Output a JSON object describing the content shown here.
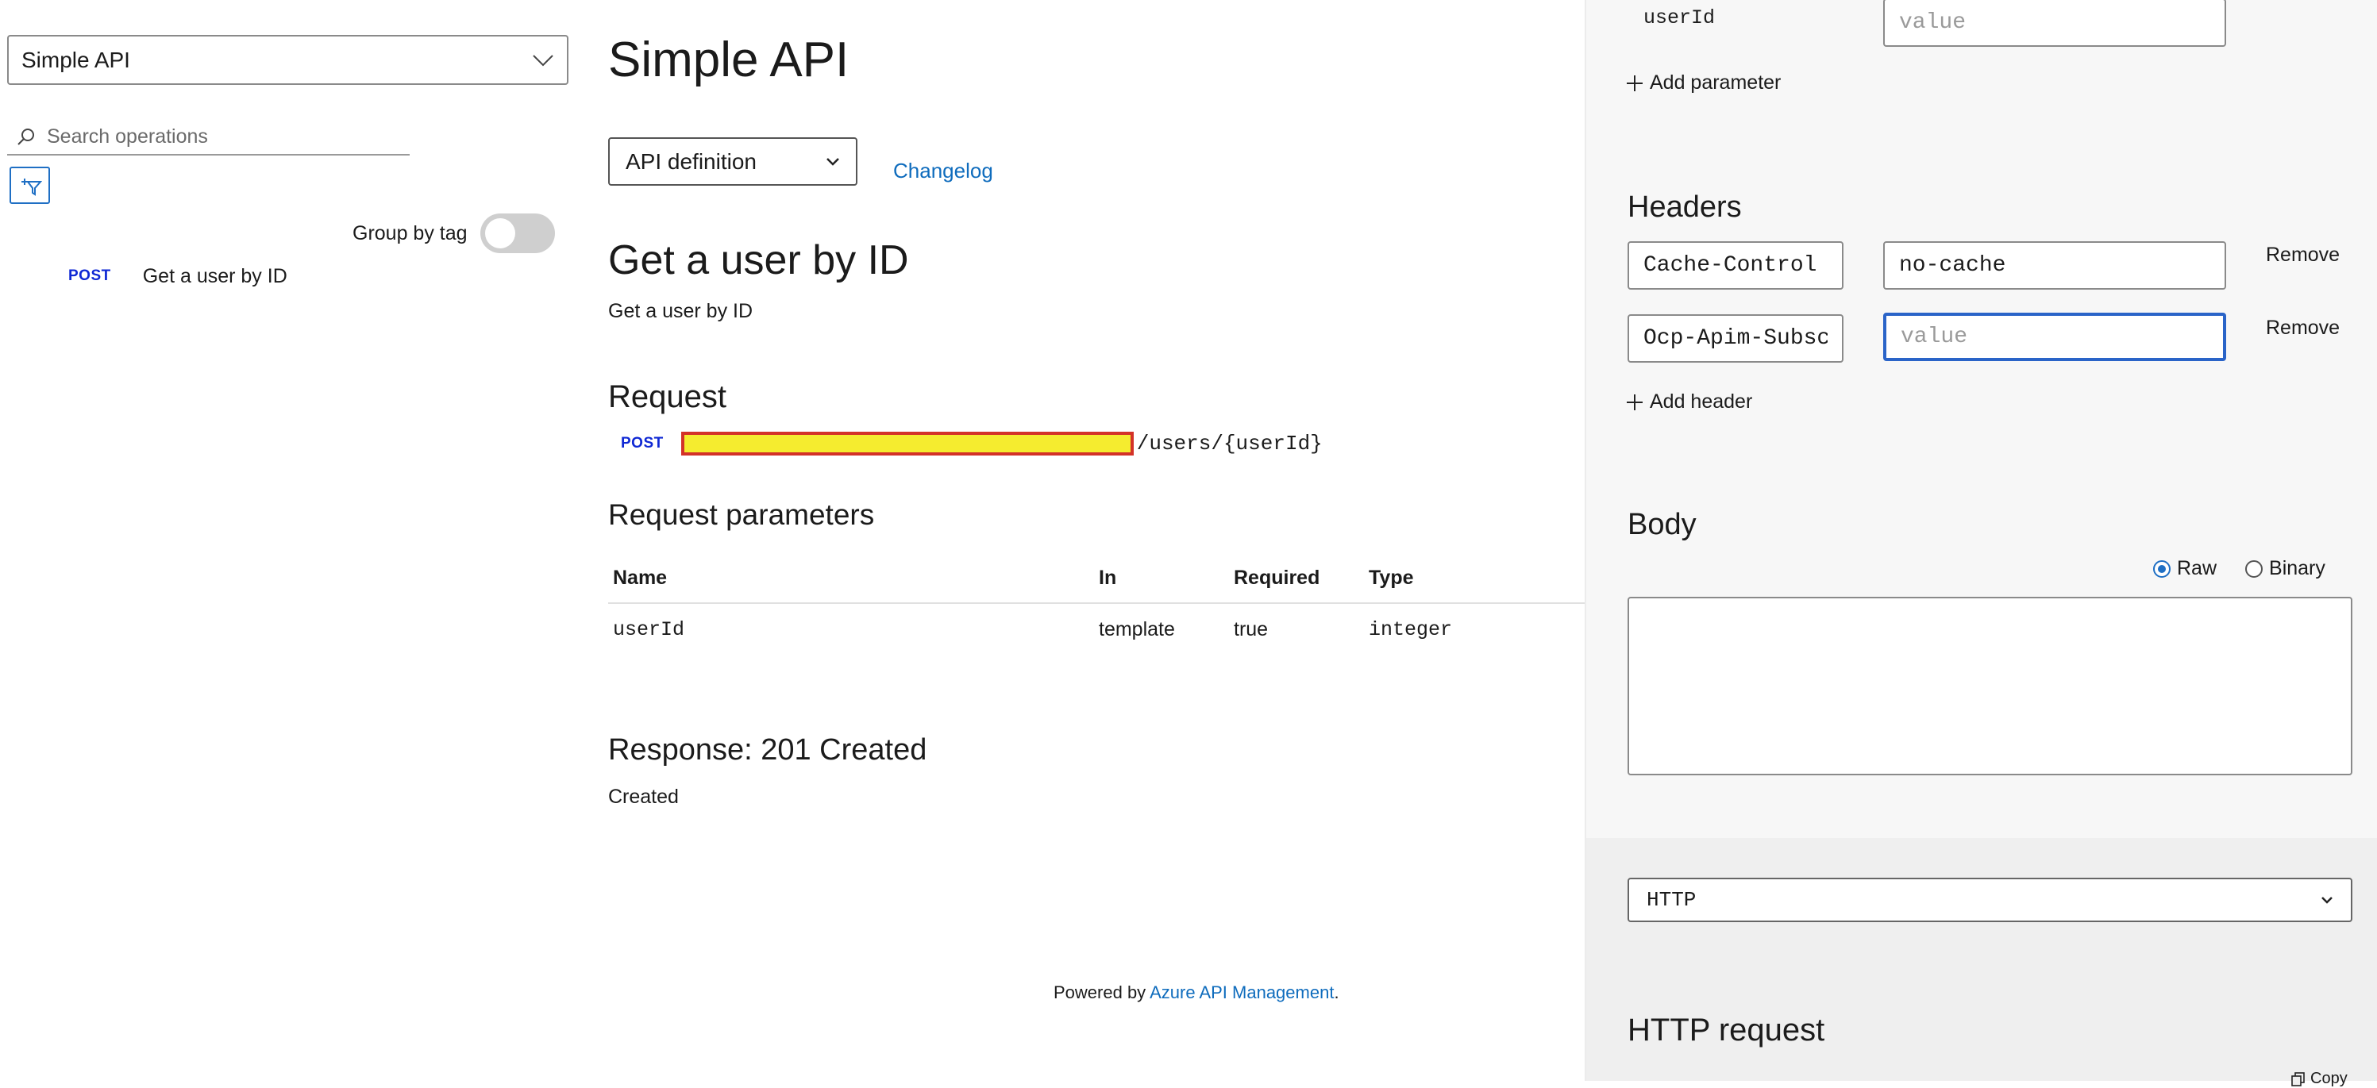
{
  "sidebar": {
    "api_select_value": "Simple API",
    "search_placeholder": "Search operations",
    "group_by_tag_label": "Group by tag",
    "operations": [
      {
        "method": "POST",
        "name": "Get a user by ID"
      }
    ]
  },
  "main": {
    "title": "Simple API",
    "definition_select_value": "API definition",
    "changelog_label": "Changelog",
    "operation_title": "Get a user by ID",
    "operation_description": "Get a user by ID",
    "request_heading": "Request",
    "request_method": "POST",
    "request_path": "/users/{userId}",
    "request_params_heading": "Request parameters",
    "params_table": {
      "headers": [
        "Name",
        "In",
        "Required",
        "Type"
      ],
      "rows": [
        [
          "userId",
          "template",
          "true",
          "integer"
        ]
      ]
    },
    "response_heading": "Response: 201 Created",
    "response_description": "Created",
    "footer_prefix": "Powered by ",
    "footer_link": "Azure API Management",
    "footer_suffix": "."
  },
  "console": {
    "param_name": "userId",
    "param_value_placeholder": "value",
    "add_parameter_label": "Add parameter",
    "headers_heading": "Headers",
    "headers": [
      {
        "name": "Cache-Control",
        "value": "no-cache",
        "remove_label": "Remove"
      },
      {
        "name": "Ocp-Apim-Subscription-Key",
        "value": "",
        "value_placeholder": "value",
        "remove_label": "Remove"
      }
    ],
    "add_header_label": "Add header",
    "body_heading": "Body",
    "body_formats": [
      "Raw",
      "Binary"
    ],
    "body_format_selected": "Raw",
    "protocol_select_value": "HTTP",
    "http_request_heading": "HTTP request",
    "copy_label": "Copy"
  },
  "colors": {
    "accent": "#1f6fc4",
    "link": "#0f6cbd",
    "method_post": "#0f28d4",
    "redaction_fill": "#f5ec2f",
    "redaction_border": "#d33228"
  }
}
